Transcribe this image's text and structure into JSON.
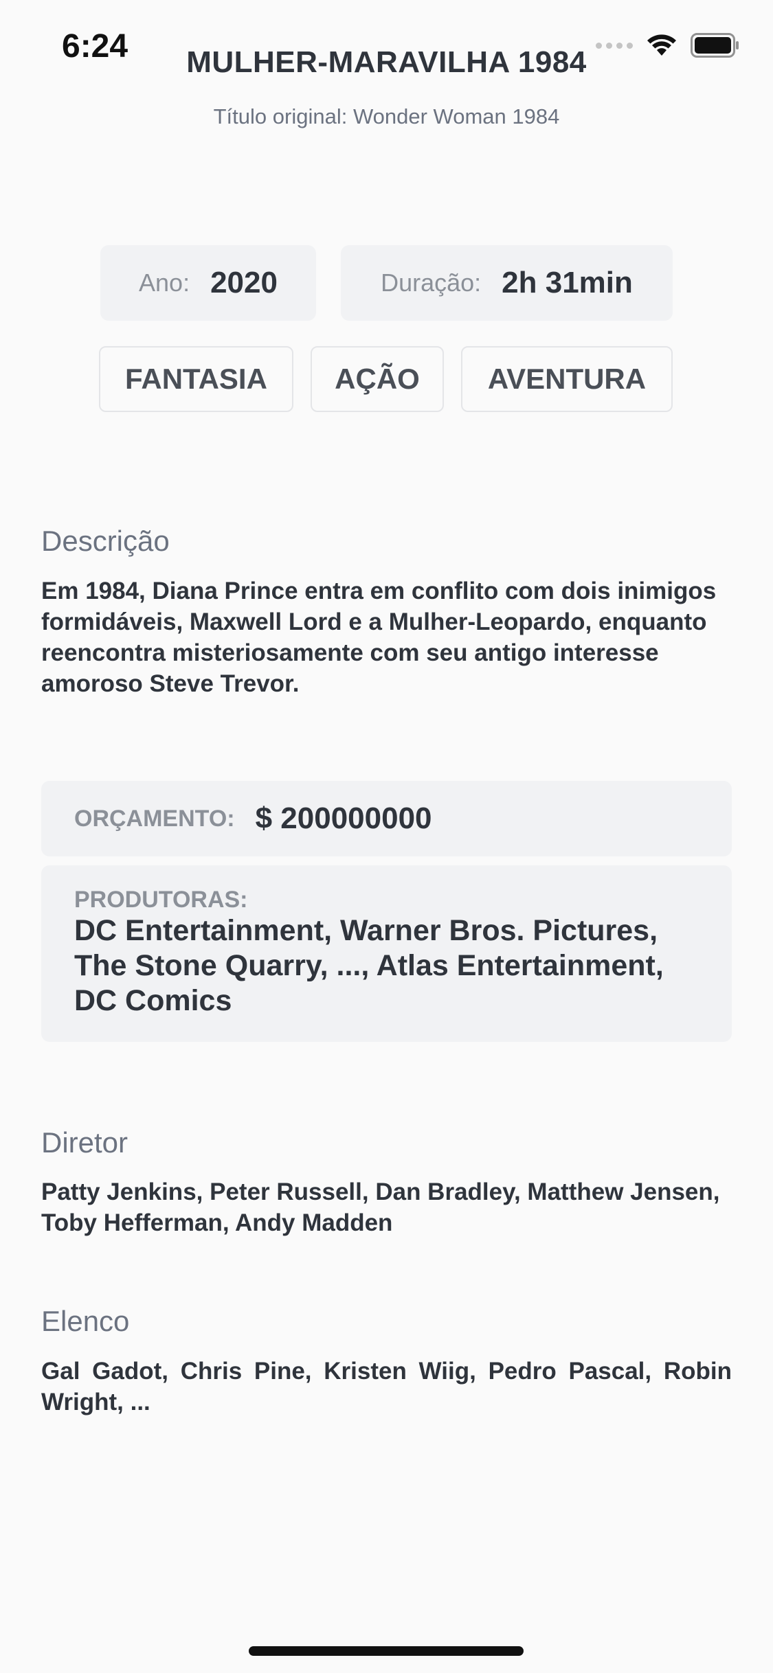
{
  "status_bar": {
    "time": "6:24"
  },
  "header": {
    "title": "MULHER-MARAVILHA 1984",
    "subtitle": "Título original: Wonder Woman 1984"
  },
  "info": {
    "year_label": "Ano:",
    "year_value": "2020",
    "duration_label": "Duração:",
    "duration_value": "2h 31min"
  },
  "genres": [
    "FANTASIA",
    "AÇÃO",
    "AVENTURA"
  ],
  "description": {
    "heading": "Descrição",
    "text": "Em 1984, Diana Prince entra em conflito com dois inimigos formidáveis, Maxwell Lord e a Mulher-Leopardo, enquanto reencontra misteriosamente com seu antigo interesse amoroso Steve Trevor."
  },
  "budget": {
    "label": "ORÇAMENTO:",
    "value": "$ 200000000"
  },
  "producers": {
    "label": "PRODUTORAS:",
    "value": "DC Entertainment, Warner Bros. Pictures, The Stone Quarry, ..., Atlas Entertainment, DC Comics"
  },
  "director": {
    "heading": "Diretor",
    "text": "Patty Jenkins, Peter Russell, Dan Bradley, Matthew Jensen, Toby Hefferman, Andy Madden"
  },
  "cast": {
    "heading": "Elenco",
    "text": "Gal Gadot, Chris Pine, Kristen Wiig, Pedro Pascal, Robin Wright, ..."
  }
}
